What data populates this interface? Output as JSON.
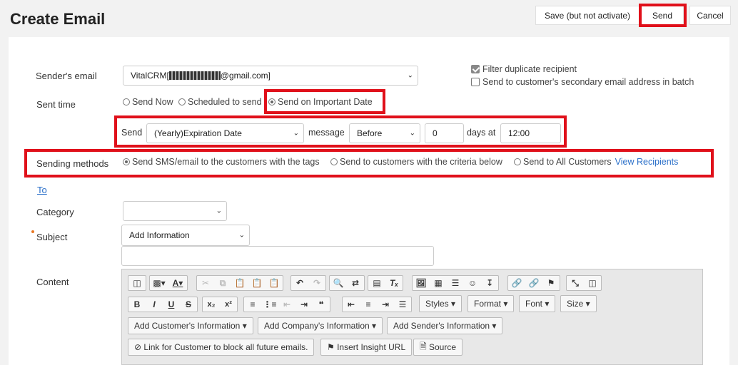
{
  "header": {
    "title": "Create Email",
    "save_label": "Save (but not activate)",
    "send_label": "Send",
    "cancel_label": "Cancel"
  },
  "sender": {
    "label": "Sender's email",
    "value_prefix": "VitalCRM[",
    "value_suffix": "@gmail.com]"
  },
  "options": {
    "filter_duplicate": "Filter duplicate recipient",
    "filter_duplicate_checked": true,
    "secondary_email": "Send to customer's secondary email address in batch",
    "secondary_email_checked": false
  },
  "sent_time": {
    "label": "Sent time",
    "send_now": "Send Now",
    "scheduled": "Scheduled to send",
    "important_date": "Send on Important Date",
    "selected": "important_date"
  },
  "schedule": {
    "send_label": "Send",
    "date_field": "(Yearly)Expiration Date",
    "message_label": "message",
    "relation": "Before",
    "days": "0",
    "days_at_label": "days at",
    "time": "12:00"
  },
  "methods": {
    "label": "Sending methods",
    "tags": "Send SMS/email to the customers with the tags",
    "criteria": "Send to customers with the criteria below",
    "all": "Send to All Customers",
    "view_recipients": "View Recipients",
    "selected": "tags"
  },
  "to_link": "To",
  "category": {
    "label": "Category",
    "value": ""
  },
  "subject": {
    "label": "Subject",
    "dropdown": "Add Information",
    "value": ""
  },
  "content": {
    "label": "Content",
    "styles": "Styles",
    "format": "Format",
    "font": "Font",
    "size": "Size",
    "add_customer_info": "Add Customer's Information",
    "add_company_info": "Add Company's Information",
    "add_sender_info": "Add Sender's Information",
    "block_link": "Link for Customer to block all future emails.",
    "insight_url": "Insert Insight URL",
    "source": "Source"
  },
  "colors": {
    "highlight": "#e0101a",
    "link": "#2a6fc9"
  }
}
